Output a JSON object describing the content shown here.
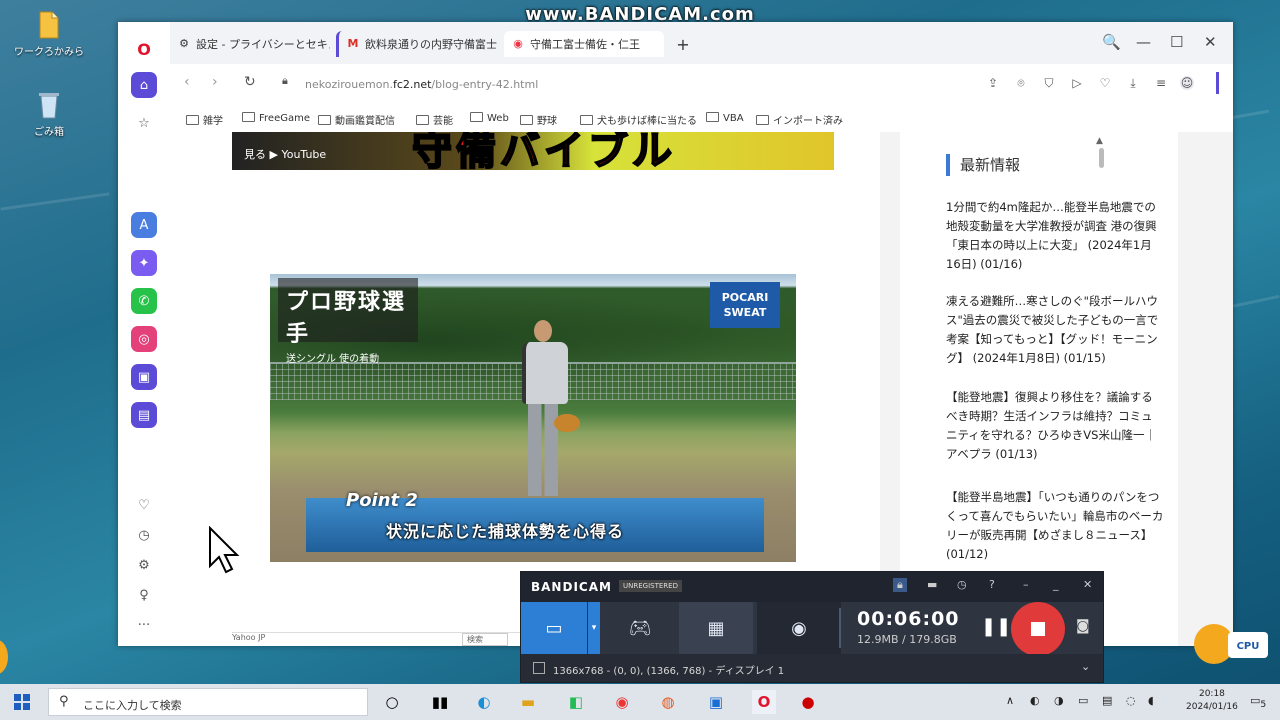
{
  "watermark": "www.BANDICAM.com",
  "desktop": {
    "icons": [
      {
        "name": "file-icon",
        "label": "ワークろかみら"
      },
      {
        "name": "recycle-bin-icon",
        "label": "ごみ箱"
      }
    ]
  },
  "browser": {
    "tabs": [
      {
        "title": "設定 - プライバシーとセキュリ",
        "icon": "gear-icon"
      },
      {
        "title": "飲料泉通りの内野守備富士",
        "icon": "gmail-icon"
      },
      {
        "title": "守備工富士備佐・仁王",
        "icon": "site-icon"
      }
    ],
    "new_tab": "+",
    "url_prefix": "nekozirouemon.",
    "url_domain": "fc2.net",
    "url_path": "/blog-entry-42.html",
    "bookmarks": [
      "雑学",
      "FreeGame",
      "動画鑑賞配信",
      "芸能",
      "Web",
      "野球",
      "犬も歩けば棒に当たる",
      "VBA",
      "インポート済み"
    ],
    "window_controls": {
      "search": "🔍",
      "minimize": "—",
      "maximize": "☐",
      "close": "✕"
    }
  },
  "page": {
    "banner_text": "守備バイブル",
    "banner_sub": "見る ▶ YouTube",
    "video": {
      "logo_line1": "プロ野球選手",
      "logo_line2": "送シングル 使の着動",
      "sponsor": "POCARI SWEAT",
      "point": "Point 2",
      "caption": "状況に応じた捕球体勢を心得る"
    },
    "footer_left": "Yahoo JP",
    "footer_mid": "検索",
    "sidebar_title": "最新情報",
    "news": [
      "1分間で約4m隆起か…能登半島地震での地殻変動量を大学准教授が調査 港の復興「東日本の時以上に大変」 (2024年1月16日) (01/16)",
      "凍える避難所…寒さしのぐ\"段ボールハウス\"過去の震災で被災した子どもの一言で考案【知ってもっと】【グッド！モーニング】 (2024年1月8日) (01/15)",
      "【能登地震】復興より移住を？議論するべき時期？生活インフラは維持？コミュニティを守れる？ひろゆきVS米山隆一｜アベプラ (01/13)",
      "【能登半島地震】「いつも通りのパンをつくって喜んでもらいたい」輪島市のベーカリーが販売再開【めざまし８ニュース】 (01/12)"
    ]
  },
  "bandicam": {
    "logo": "BANDICAM",
    "status": "UNREGISTERED",
    "timer": "00:06:00",
    "size": "12.9MB / 179.8GB",
    "region": "1366x768 - (0, 0), (1366, 768) - ディスプレイ 1",
    "modes": [
      "screen",
      "game",
      "hdmi",
      "webcam"
    ]
  },
  "cpu_badge": "CPU",
  "taskbar": {
    "search_placeholder": "ここに入力して検索",
    "time": "20:18",
    "date": "2024/01/16",
    "notification_count": "5"
  }
}
